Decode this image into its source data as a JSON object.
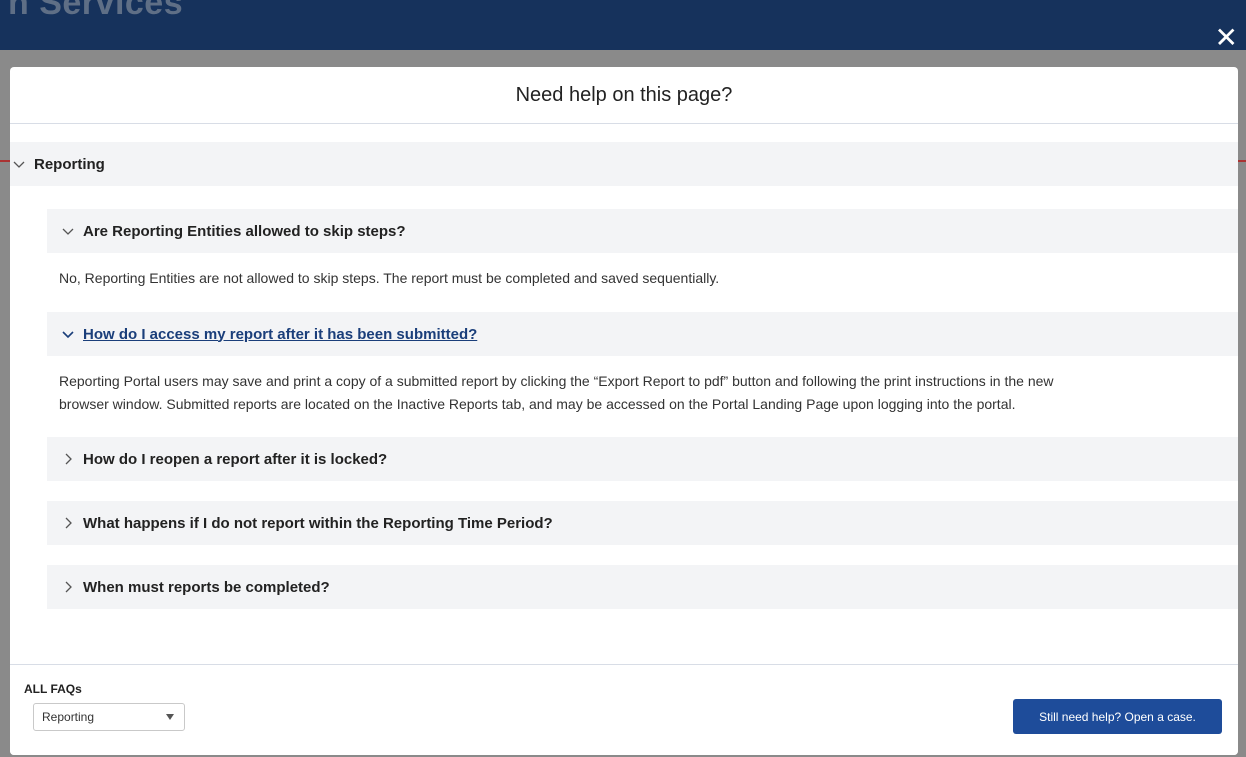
{
  "background": {
    "title_fragment": "n Services"
  },
  "modal": {
    "title": "Need help on this page?",
    "section": {
      "label": "Reporting",
      "questions": [
        {
          "question": "Are Reporting Entities allowed to skip steps?",
          "expanded": true,
          "answer": "No, Reporting Entities are not allowed to skip steps.  The report must be completed and saved sequentially."
        },
        {
          "question": "How do I access my report after it has been submitted?",
          "expanded": true,
          "answer_line1": "Reporting Portal users may save and print a copy of a submitted report by clicking the “Export Report to pdf” button and following the print instructions in the new",
          "answer_line2": "browser window. Submitted reports are located on the Inactive Reports tab, and may be accessed on the Portal Landing Page upon logging into the portal."
        },
        {
          "question": "How do I reopen a report after it is locked?",
          "expanded": false
        },
        {
          "question": "What happens if I do not report within the Reporting Time Period?",
          "expanded": false
        },
        {
          "question": "When must reports be completed?",
          "expanded": false
        }
      ]
    },
    "footer": {
      "faq_label": "ALL FAQs",
      "faq_select_value": "Reporting",
      "help_button": "Still need help? Open a case."
    }
  },
  "colors": {
    "header_bg": "#16325c",
    "button_bg": "#1e4c9a",
    "row_bg": "#f3f4f6",
    "link": "#1a3e7a"
  }
}
